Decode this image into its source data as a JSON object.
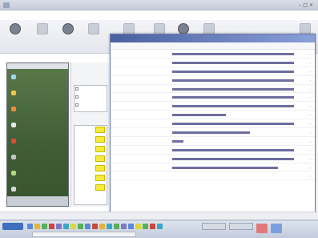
{
  "window": {
    "title": ""
  },
  "menu": [
    "",
    "",
    "",
    "",
    "",
    "",
    "",
    ""
  ],
  "toolbar": {
    "buttons": [
      {
        "label": "",
        "icon": "back-icon"
      },
      {
        "label": "",
        "icon": "forward-icon"
      },
      {
        "label": "",
        "icon": "home-icon"
      },
      {
        "label": "",
        "icon": "tool-icon"
      },
      {
        "label": "",
        "icon": "tool-icon"
      },
      {
        "label": "",
        "icon": "tool-icon"
      },
      {
        "label": "",
        "icon": "tool-icon"
      },
      {
        "label": "",
        "icon": "tool-icon"
      },
      {
        "label": "",
        "icon": "tool-icon"
      }
    ]
  },
  "sidebar": {
    "header": "",
    "items": [
      {
        "label": "",
        "color": "#9fd6f0"
      },
      {
        "label": "",
        "color": "#f2c744"
      },
      {
        "label": "",
        "color": "#f28a3a"
      },
      {
        "label": "",
        "color": "#e8e8e8"
      },
      {
        "label": "",
        "color": "#e04a3a"
      },
      {
        "label": "",
        "color": "#c6c6c6"
      },
      {
        "label": "",
        "color": "#b9d87a"
      },
      {
        "label": "",
        "color": "#d8d8d8"
      }
    ],
    "footer": ""
  },
  "dialog": {
    "title": "",
    "headers": {
      "col1": "",
      "col2": "",
      "col3": ""
    },
    "rows": [
      {
        "name": "",
        "value": 1.0,
        "bold": false
      },
      {
        "name": "",
        "value": 1.0,
        "bold": false
      },
      {
        "name": "",
        "value": 1.0,
        "bold": false
      },
      {
        "name": "",
        "value": 1.0,
        "bold": false
      },
      {
        "name": "",
        "value": 1.0,
        "bold": false
      },
      {
        "name": "",
        "value": 1.0,
        "bold": false
      },
      {
        "name": "",
        "value": 1.0,
        "bold": false
      },
      {
        "name": "",
        "value": 0.44,
        "bold": true
      },
      {
        "name": "",
        "value": 1.0,
        "bold": false
      },
      {
        "name": "",
        "value": 0.64,
        "bold": true
      },
      {
        "name": "",
        "value": 0.09,
        "bold": true
      },
      {
        "name": "",
        "value": 1.0,
        "bold": false
      },
      {
        "name": "",
        "value": 1.0,
        "bold": false
      },
      {
        "name": "",
        "value": 0.87,
        "bold": true
      },
      {
        "name": "",
        "value": 0.0,
        "bold": true
      }
    ]
  },
  "status": {
    "text": ""
  },
  "taskbar": {
    "start_label": "",
    "clock": "",
    "address": ""
  },
  "colors": {
    "bar": "#6e6e9e",
    "title_bar": "#4a5fa0",
    "sidebar_bg": "#3f5c36",
    "highlight": "#f4ea3a"
  }
}
